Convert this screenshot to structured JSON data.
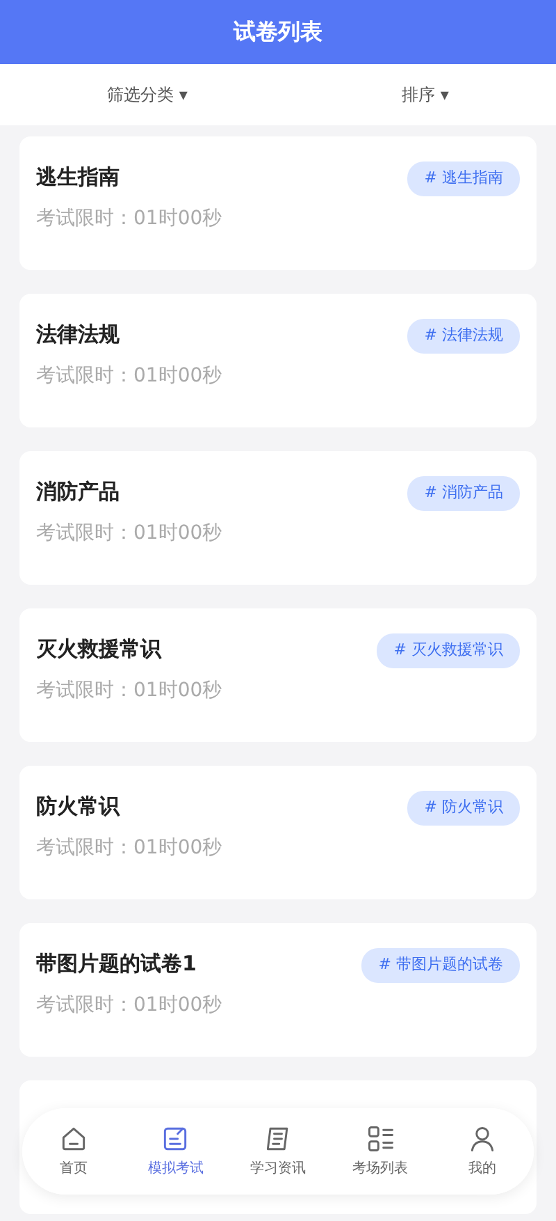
{
  "header": {
    "title": "试卷列表"
  },
  "filters": [
    {
      "label": "筛选分类",
      "caret": "▾"
    },
    {
      "label": "排序",
      "caret": "▾"
    }
  ],
  "papers": [
    {
      "title": "逃生指南",
      "limit": "考试限时：01时00秒",
      "tag": "# 逃生指南"
    },
    {
      "title": "法律法规",
      "limit": "考试限时：01时00秒",
      "tag": "# 法律法规"
    },
    {
      "title": "消防产品",
      "limit": "考试限时：01时00秒",
      "tag": "# 消防产品"
    },
    {
      "title": "灭火救援常识",
      "limit": "考试限时：01时00秒",
      "tag": "# 灭火救援常识"
    },
    {
      "title": "防火常识",
      "limit": "考试限时：01时00秒",
      "tag": "# 防火常识"
    },
    {
      "title": "带图片题的试卷1",
      "limit": "考试限时：01时00秒",
      "tag": "# 带图片题的试卷"
    }
  ],
  "tabbar": [
    {
      "label": "首页",
      "selected": false
    },
    {
      "label": "模拟考试",
      "selected": true
    },
    {
      "label": "学习资讯",
      "selected": false
    },
    {
      "label": "考场列表",
      "selected": false
    },
    {
      "label": "我的",
      "selected": false
    }
  ]
}
